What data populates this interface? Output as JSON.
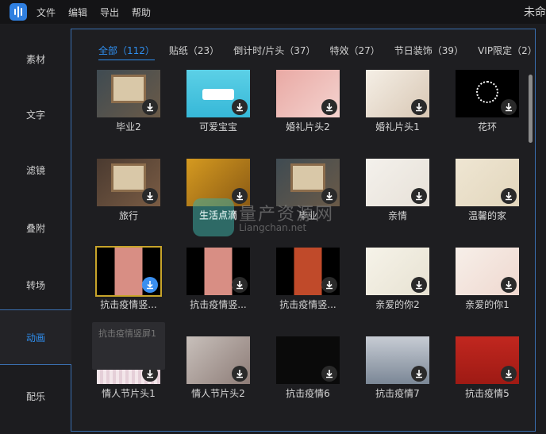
{
  "menubar": {
    "items": [
      "文件",
      "编辑",
      "导出",
      "帮助"
    ],
    "window_title": "未命"
  },
  "sidebar": {
    "items": [
      {
        "label": "素材"
      },
      {
        "label": "文字"
      },
      {
        "label": "滤镜"
      },
      {
        "label": "叠附"
      },
      {
        "label": "转场"
      },
      {
        "label": "动画",
        "active": true
      },
      {
        "label": "配乐"
      }
    ]
  },
  "tabs": [
    {
      "label": "全部（112）",
      "active": true
    },
    {
      "label": "贴纸（23）"
    },
    {
      "label": "倒计时/片头（37）"
    },
    {
      "label": "特效（27）"
    },
    {
      "label": "节日装饰（39）"
    },
    {
      "label": "VIP限定（2）"
    }
  ],
  "items": [
    {
      "label": "毕业2",
      "theme": "wood-frame"
    },
    {
      "label": "可爱宝宝",
      "theme": "cute-blue"
    },
    {
      "label": "婚礼片头2",
      "theme": "wedding-pink"
    },
    {
      "label": "婚礼片头1",
      "theme": "wedding-flowers"
    },
    {
      "label": "花环",
      "theme": "wreath"
    },
    {
      "label": "旅行",
      "theme": "travel"
    },
    {
      "label": "生活点滴",
      "theme": "autumn"
    },
    {
      "label": "毕业",
      "theme": "wood-frame"
    },
    {
      "label": "亲情",
      "theme": "script-white"
    },
    {
      "label": "温馨的家",
      "theme": "beige"
    },
    {
      "label": "抗击疫情竖...",
      "theme": "vertical-pink",
      "selected": true
    },
    {
      "label": "抗击疫情竖...",
      "theme": "vertical-pink"
    },
    {
      "label": "抗击疫情竖...",
      "theme": "vertical-temple"
    },
    {
      "label": "亲爱的你2",
      "theme": "cream"
    },
    {
      "label": "亲爱的你1",
      "theme": "floral-frame"
    },
    {
      "label": "情人节片头1",
      "theme": "stripe-pink"
    },
    {
      "label": "情人节片头2",
      "theme": "girl-photo"
    },
    {
      "label": "抗击疫情6",
      "theme": "black-red"
    },
    {
      "label": "抗击疫情7",
      "theme": "wuhan-photo"
    },
    {
      "label": "抗击疫情5",
      "theme": "red-banner"
    }
  ],
  "tooltip": {
    "text": "抗击疫情竖屏1"
  },
  "watermark": {
    "line1": "生活点滴",
    "line2": "量产资源网",
    "line3": "Liangchan.net"
  },
  "colors": {
    "accent": "#2f8ff0",
    "panel_border": "#3a6fb0",
    "selected_outline": "#c7a42a"
  }
}
